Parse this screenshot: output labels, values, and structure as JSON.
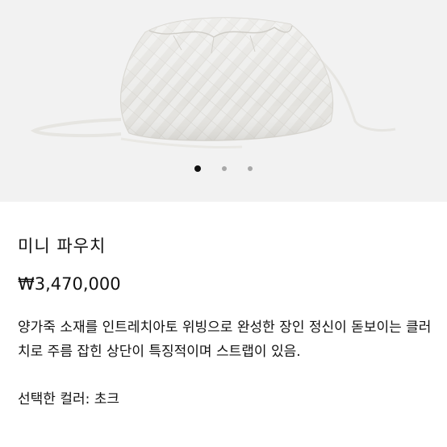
{
  "gallery": {
    "image_alt": "white woven leather pouch",
    "dots": [
      {
        "active": true
      },
      {
        "active": false
      },
      {
        "active": false
      }
    ]
  },
  "product": {
    "name": "미니 파우치",
    "price": "₩3,470,000",
    "description": "양가죽 소재를 인트레치아토 위빙으로 완성한 장인 정신이 돋보이는 클러치로 주름 잡힌 상단이 특징적이며 스트랩이 있음.",
    "selected_color": "선택한 컬러: 초크"
  }
}
